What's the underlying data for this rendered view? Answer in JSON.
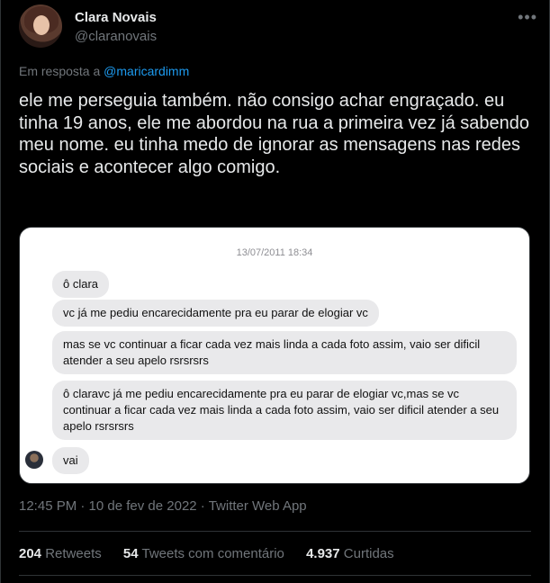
{
  "author": {
    "display_name": "Clara Novais",
    "handle": "@claranovais"
  },
  "replying_to": {
    "prefix": "Em resposta a",
    "mention": "@maricardimm"
  },
  "tweet_text": "ele me perseguia também. não consigo achar engraçado. eu tinha 19 anos, ele me abordou na rua a primeira vez já sabendo meu nome. eu tinha medo de ignorar as mensagens nas redes sociais e acontecer algo comigo.",
  "media": {
    "chat_date": "13/07/2011 18:34",
    "messages": [
      "ô clara",
      "vc já me pediu encarecidamente pra eu parar de elogiar vc",
      "mas se vc continuar a ficar cada vez mais linda a cada foto assim, vaio ser dificil atender a seu apelo rsrsrsrs",
      "ô claravc já me pediu encarecidamente pra eu parar de elogiar vc,mas se vc continuar a ficar cada vez mais linda a cada foto assim, vaio ser dificil atender a seu apelo rsrsrsrs",
      "vai"
    ]
  },
  "meta": "12:45 PM · 10 de fev de 2022 · Twitter Web App",
  "stats": {
    "retweets_count": "204",
    "retweets_label": "Retweets",
    "quotes_count": "54",
    "quotes_label": "Tweets com comentário",
    "likes_count": "4.937",
    "likes_label": "Curtidas"
  },
  "icons": {
    "more": "more-horizontal-icon"
  }
}
